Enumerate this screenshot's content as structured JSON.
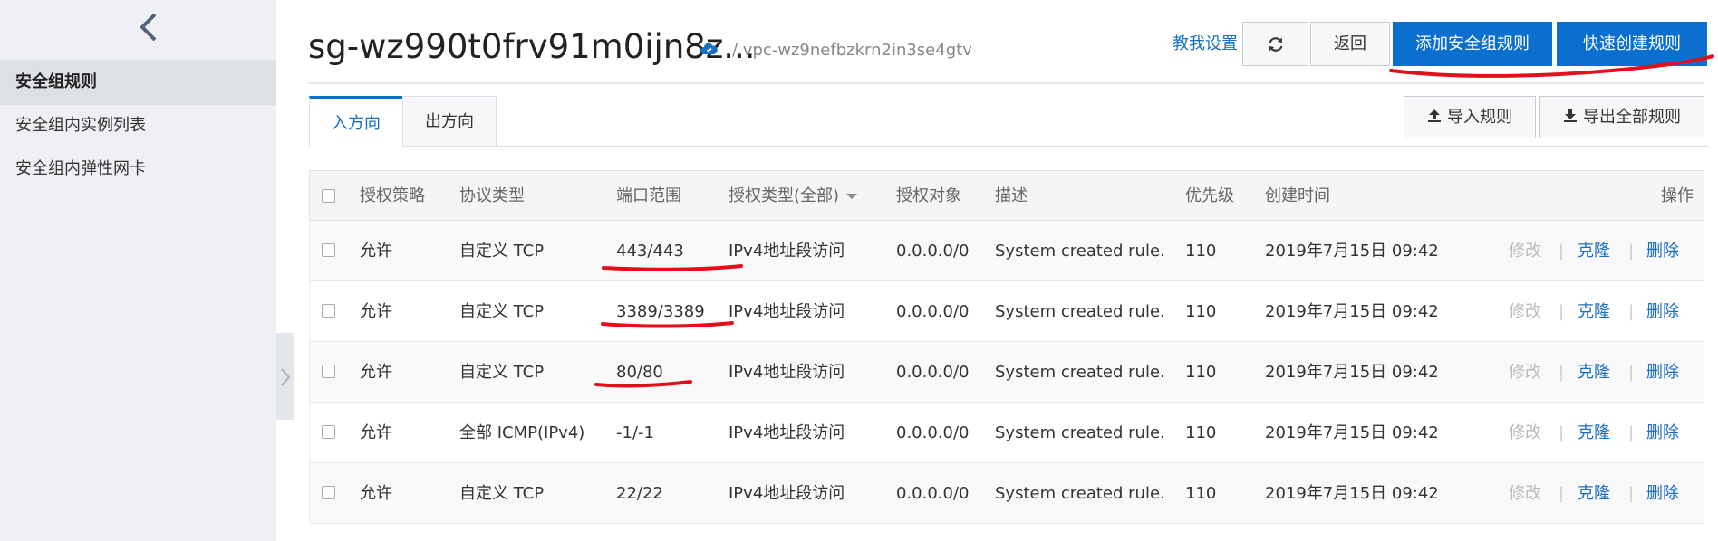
{
  "sidebar": {
    "items": [
      {
        "label": "安全组规则",
        "active": true
      },
      {
        "label": "安全组内实例列表",
        "active": false
      },
      {
        "label": "安全组内弹性网卡",
        "active": false
      }
    ]
  },
  "header": {
    "title": "sg-wz990t0frv91m0ijn8z...",
    "vpc": "/ vpc-wz9nefbzkrn2in3se4gtv",
    "help_link": "教我设置",
    "back_label": "返回",
    "add_rule_label": "添加安全组规则",
    "quick_create_label": "快速创建规则"
  },
  "tabs": [
    {
      "label": "入方向",
      "active": true
    },
    {
      "label": "出方向",
      "active": false
    }
  ],
  "toolbar": {
    "import_label": "导入规则",
    "export_label": "导出全部规则"
  },
  "table": {
    "headers": {
      "policy": "授权策略",
      "protocol": "协议类型",
      "port": "端口范围",
      "auth_type": "授权类型(全部)",
      "auth_object": "授权对象",
      "description": "描述",
      "priority": "优先级",
      "created": "创建时间",
      "actions": "操作"
    },
    "actions": {
      "edit": "修改",
      "clone": "克隆",
      "delete": "删除"
    },
    "rows": [
      {
        "policy": "允许",
        "protocol": "自定义 TCP",
        "port": "443/443",
        "auth_type": "IPv4地址段访问",
        "auth_object": "0.0.0.0/0",
        "description": "System created rule.",
        "priority": "110",
        "created": "2019年7月15日 09:42"
      },
      {
        "policy": "允许",
        "protocol": "自定义 TCP",
        "port": "3389/3389",
        "auth_type": "IPv4地址段访问",
        "auth_object": "0.0.0.0/0",
        "description": "System created rule.",
        "priority": "110",
        "created": "2019年7月15日 09:42"
      },
      {
        "policy": "允许",
        "protocol": "自定义 TCP",
        "port": "80/80",
        "auth_type": "IPv4地址段访问",
        "auth_object": "0.0.0.0/0",
        "description": "System created rule.",
        "priority": "110",
        "created": "2019年7月15日 09:42"
      },
      {
        "policy": "允许",
        "protocol": "全部 ICMP(IPv4)",
        "port": "-1/-1",
        "auth_type": "IPv4地址段访问",
        "auth_object": "0.0.0.0/0",
        "description": "System created rule.",
        "priority": "110",
        "created": "2019年7月15日 09:42"
      },
      {
        "policy": "允许",
        "protocol": "自定义 TCP",
        "port": "22/22",
        "auth_type": "IPv4地址段访问",
        "auth_object": "0.0.0.0/0",
        "description": "System created rule.",
        "priority": "110",
        "created": "2019年7月15日 09:42"
      }
    ]
  },
  "colors": {
    "primary": "#0a6fcf",
    "link": "#1a6fc2",
    "annotation": "#e3101c"
  }
}
